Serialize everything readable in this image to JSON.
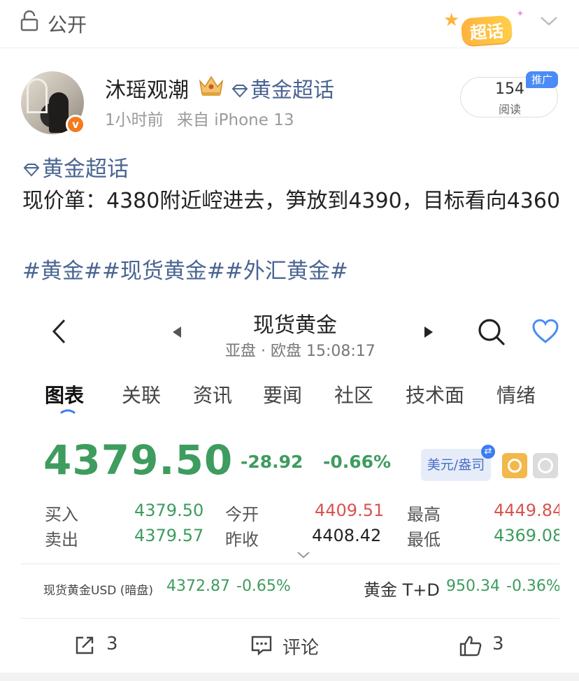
{
  "topbar": {
    "privacy": "公开",
    "chaohua_badge": "超话"
  },
  "author": {
    "name": "沐瑶观潮",
    "verified_badge": "v",
    "topic": "黄金超话",
    "time": "1小时前",
    "source": "来自 iPhone 13",
    "read_count": "154",
    "read_label": "阅读",
    "promo": "推广"
  },
  "post": {
    "topic": "黄金超话",
    "text": "现价箪：4380附近崆进去，笋放到4390，目标看向4360",
    "hashtags": "#黄金##现货黄金##外汇黄金#"
  },
  "embedded": {
    "title": "现货黄金",
    "subtitle": "亚盘 · 欧盘 15:08:17",
    "tabs": [
      "图表",
      "关联",
      "资讯",
      "要闻",
      "社区",
      "技术面",
      "情绪"
    ],
    "price": "4379.50",
    "change": "-28.92",
    "change_pct": "-0.66%",
    "unit": "美元/盎司",
    "swap_icon": "⇄",
    "quote": {
      "buy_label": "买入",
      "buy": "4379.50",
      "sell_label": "卖出",
      "sell": "4379.57",
      "open_label": "今开",
      "open": "4409.51",
      "prev_label": "昨收",
      "prev": "4408.42",
      "high_label": "最高",
      "high": "4449.84",
      "low_label": "最低",
      "low": "4369.08"
    },
    "ticker1": {
      "name": "现货黄金USD (暗盘)",
      "value": "4372.87",
      "pct": "-0.65%"
    },
    "ticker2": {
      "name": "黄金 T+D",
      "value": "950.34",
      "pct": "-0.36%"
    }
  },
  "actions": {
    "share_count": "3",
    "comment_label": "评论",
    "like_count": "3"
  },
  "colors": {
    "link_blue": "#4a6592",
    "price_green": "#3e9c5e",
    "price_red": "#d9534f",
    "promo_blue": "#4a8bf5",
    "verified_orange": "#f27b1d"
  },
  "icons": [
    "lock-icon",
    "chevron-down-icon",
    "crown-icon",
    "diamond-icon",
    "back-arrow-icon",
    "search-icon",
    "heart-icon",
    "share-icon",
    "comment-icon",
    "like-icon"
  ]
}
